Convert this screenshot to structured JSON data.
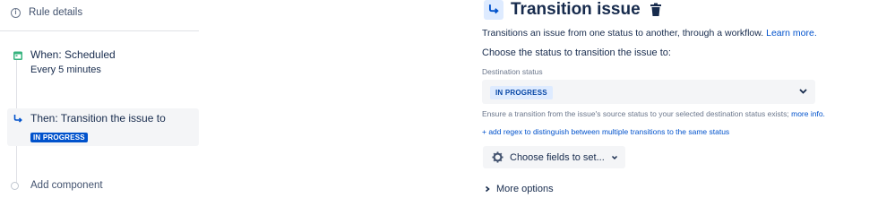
{
  "sidebar": {
    "rule_details": "Rule details",
    "when": {
      "title": "When: Scheduled",
      "subtitle": "Every 5 minutes"
    },
    "then": {
      "title": "Then: Transition the issue to",
      "status": "IN PROGRESS"
    },
    "add_component": "Add component"
  },
  "panel": {
    "title": "Transition issue",
    "description": "Transitions an issue from one status to another, through a workflow.",
    "learn_more": "Learn more.",
    "choose_label": "Choose the status to transition the issue to:",
    "destination_label": "Destination status",
    "destination_value": "IN PROGRESS",
    "hint": "Ensure a transition from the issue's source status to your selected destination status exists;",
    "hint_link": "more info.",
    "add_regex": "+ add regex to distinguish between multiple transitions to the same status",
    "choose_fields": "Choose fields to set...",
    "more_options": "More options"
  },
  "colors": {
    "accent": "#0052cc",
    "lozenge_light_bg": "#deebff",
    "selected_bg": "#f4f5f7"
  }
}
